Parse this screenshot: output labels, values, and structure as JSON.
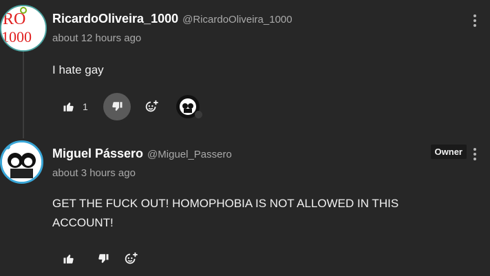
{
  "comments": [
    {
      "author": "RicardoOliveira_1000",
      "handle": "@RicardoOliveira_1000",
      "time": "about 12 hours ago",
      "text": "I hate gay",
      "avatar_text": "RO 1000",
      "like_count": "1"
    },
    {
      "author": "Miguel Pássero",
      "handle": "@Miguel_Passero",
      "time": "about 3 hours ago",
      "text": "GET THE FUCK OUT! HOMOPHOBIA IS NOT ALLOWED IN THIS ACCOUNT!",
      "badge": "Owner"
    }
  ],
  "icons": {
    "like": "thumbs-up-icon",
    "dislike": "thumbs-down-icon",
    "reply": "reply-emoji-icon",
    "more": "more-vert-icon"
  },
  "colors": {
    "background": "#272727",
    "avatar_ring_1": "#4aa3a0",
    "avatar_ring_2": "#3aa7d8",
    "avatar_text_red": "#e02020"
  }
}
